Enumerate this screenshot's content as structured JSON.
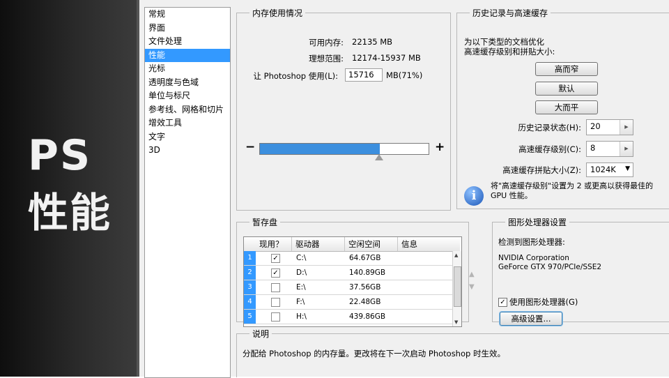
{
  "overlay": {
    "title_line1": "PS",
    "title_line2": "性能"
  },
  "nav": {
    "items": [
      "常规",
      "界面",
      "文件处理",
      "性能",
      "光标",
      "透明度与色域",
      "单位与标尺",
      "参考线、网格和切片",
      "增效工具",
      "文字",
      "3D"
    ],
    "active_index": 3
  },
  "memory": {
    "legend": "内存使用情况",
    "available_label": "可用内存:",
    "available_value": "22135 MB",
    "ideal_label": "理想范围:",
    "ideal_value": "12174-15937 MB",
    "use_label": "让 Photoshop 使用(L):",
    "use_value": "15716",
    "use_unit": "MB(71%)",
    "slider_percent": 71,
    "minus": "−",
    "plus": "+"
  },
  "history": {
    "legend": "历史记录与高速缓存",
    "desc_line1": "为以下类型的文档优化",
    "desc_line2": "高速缓存级别和拼贴大小:",
    "btn_tall_thin": "高而窄",
    "btn_default": "默认",
    "btn_big_flat": "大而平",
    "states_label": "历史记录状态(H):",
    "states_value": "20",
    "cache_levels_label": "高速缓存级别(C):",
    "cache_levels_value": "8",
    "tile_size_label": "高速缓存拼贴大小(Z):",
    "tile_size_value": "1024K",
    "info_line1": "将\"高速缓存级别\"设置为 2 或更高以获得最佳的",
    "info_line2": "GPU 性能。"
  },
  "scratch": {
    "legend": "暂存盘",
    "headers": [
      "现用？",
      "驱动器",
      "空闲空间",
      "信息"
    ],
    "rows": [
      {
        "num": "1",
        "active": true,
        "drive": "C:\\",
        "free": "64.67GB"
      },
      {
        "num": "2",
        "active": true,
        "drive": "D:\\",
        "free": "140.89GB"
      },
      {
        "num": "3",
        "active": false,
        "drive": "E:\\",
        "free": "37.56GB"
      },
      {
        "num": "4",
        "active": false,
        "drive": "F:\\",
        "free": "22.48GB"
      },
      {
        "num": "5",
        "active": false,
        "drive": "H:\\",
        "free": "439.86GB"
      }
    ]
  },
  "gpu": {
    "legend": "图形处理器设置",
    "detected_label": "检测到图形处理器:",
    "gpu_line1": "NVIDIA Corporation",
    "gpu_line2": "GeForce GTX 970/PCIe/SSE2",
    "use_gpu_label": "使用图形处理器(G)",
    "use_gpu_checked": true,
    "advanced_button": "高级设置..."
  },
  "description": {
    "legend": "说明",
    "text": "分配给 Photoshop 的内存量。更改将在下一次启动 Photoshop 时生效。"
  }
}
